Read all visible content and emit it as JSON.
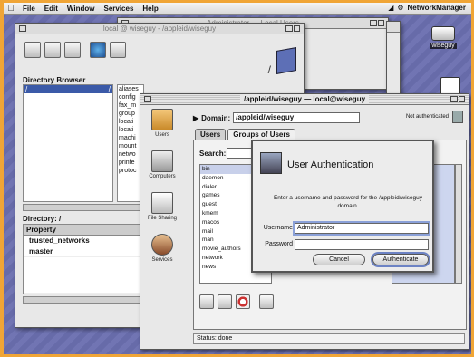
{
  "menubar": {
    "items": [
      "File",
      "Edit",
      "Window",
      "Services",
      "Help"
    ],
    "right_app": "NetworkManager"
  },
  "desktop": {
    "icon_label": "wiseguy"
  },
  "back_window": {
    "title": "Administrator — Local Users"
  },
  "local_window": {
    "title": "local @ wiseguy - /appleid/wiseguy",
    "directory_browser_label": "Directory Browser",
    "root_item": "/",
    "root_marker": "/",
    "sub_items": [
      "aliases",
      "config",
      "fax_m",
      "group",
      "locati",
      "locati",
      "machi",
      "mount",
      "netwo",
      "printe",
      "protoc"
    ],
    "directory_label": "Directory: /",
    "property_header": "Property",
    "properties": [
      "trusted_networks",
      "master"
    ]
  },
  "main_window": {
    "title": "/appleid/wiseguy — local@wiseguy",
    "sidebar": [
      {
        "label": "Users"
      },
      {
        "label": "Computers"
      },
      {
        "label": "File Sharing"
      },
      {
        "label": "Services"
      }
    ],
    "domain_label": "Domain:",
    "domain_value": "/appleid/wiseguy",
    "auth_status": "Not authenticated",
    "tabs": [
      "Users",
      "Groups of Users"
    ],
    "search_label": "Search:",
    "users": [
      "bin",
      "daemon",
      "dialer",
      "games",
      "guest",
      "kmem",
      "macos",
      "mail",
      "man",
      "movie_authors",
      "network",
      "news"
    ],
    "status": "Status: done"
  },
  "auth_dialog": {
    "title": "User Authentication",
    "message": "Enter a username and password for the /appleid/wiseguy domain.",
    "username_label": "Username",
    "username_value": "Administrator",
    "password_label": "Password",
    "password_value": "",
    "cancel_label": "Cancel",
    "authenticate_label": "Authenticate"
  },
  "colors": {
    "desktop": "#6b6fb0",
    "frame": "#f0a536",
    "selection": "#3b5aa8",
    "default_button_ring": "#6d83c4"
  }
}
